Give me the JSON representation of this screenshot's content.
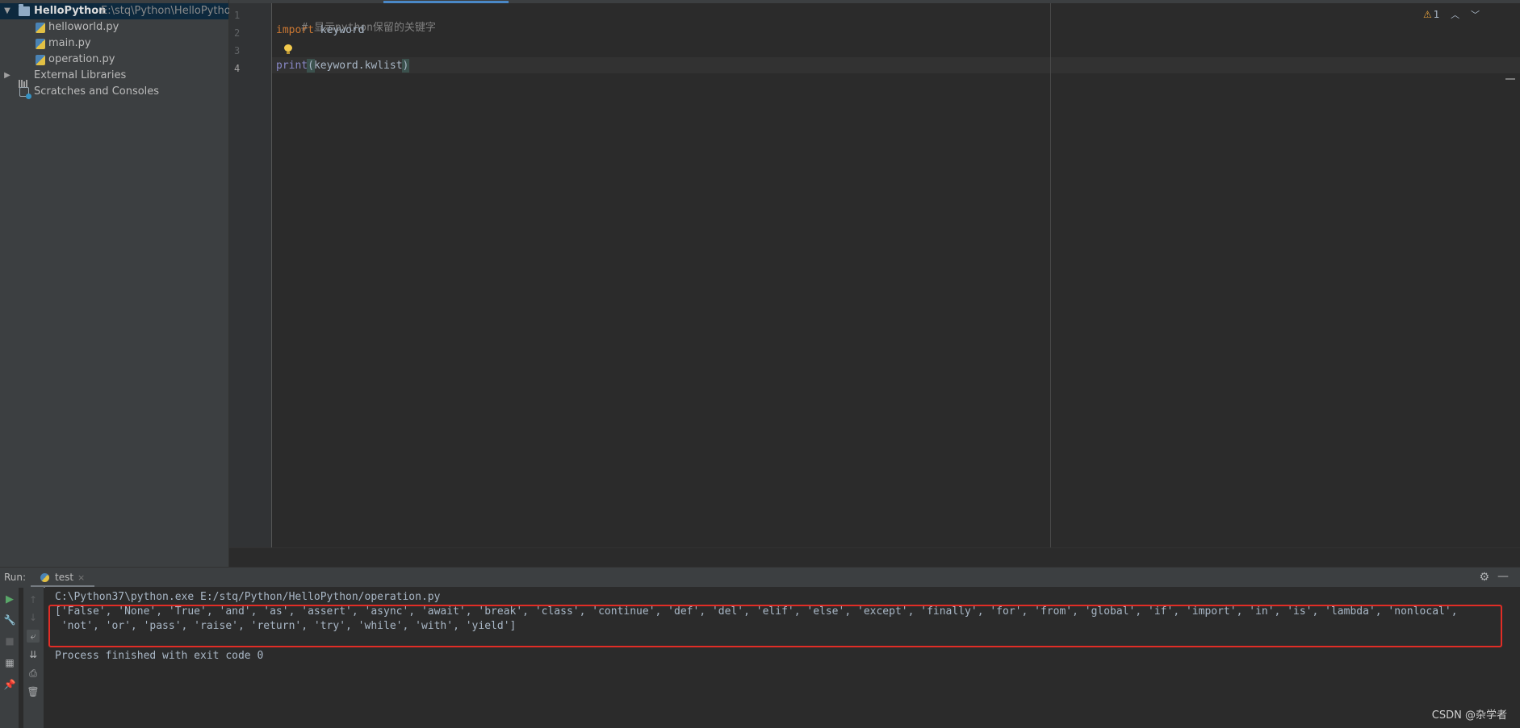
{
  "project_tree": {
    "root_name": "HelloPython",
    "root_path": "E:\\stq\\Python\\HelloPython",
    "files": [
      "helloworld.py",
      "main.py",
      "operation.py"
    ],
    "external_libraries": "External Libraries",
    "scratches": "Scratches and Consoles"
  },
  "editor": {
    "line_numbers": [
      "1",
      "2",
      "3",
      "4"
    ],
    "line1_comment": "# 显示python保留的关键字",
    "line2_keyword": "import",
    "line2_rest": " keyword",
    "line4_builtin": "print",
    "line4_open": "(",
    "line4_args": "keyword.kwlist",
    "line4_close": ")",
    "warning_count": "1",
    "warning_icon": "warning-icon"
  },
  "run_window": {
    "label": "Run:",
    "tab_name": "test",
    "tab_close": "×",
    "console": {
      "command": "C:\\Python37\\python.exe E:/stq/Python/HelloPython/operation.py",
      "output_line1": "['False', 'None', 'True', 'and', 'as', 'assert', 'async', 'await', 'break', 'class', 'continue', 'def', 'del', 'elif', 'else', 'except', 'finally', 'for', 'from', 'global', 'if', 'import', 'in', 'is', 'lambda', 'nonlocal',",
      "output_line2": " 'not', 'or', 'pass', 'raise', 'return', 'try', 'while', 'with', 'yield']",
      "exit_message": "Process finished with exit code 0"
    },
    "highlight_color": "#e12d26"
  },
  "watermark": "CSDN @杂学者",
  "colors": {
    "panel_bg": "#3c3f41",
    "editor_bg": "#2b2b2b",
    "keyword": "#cc7832",
    "builtin": "#8888c6",
    "comment": "#808080",
    "text": "#a9b7c6"
  }
}
